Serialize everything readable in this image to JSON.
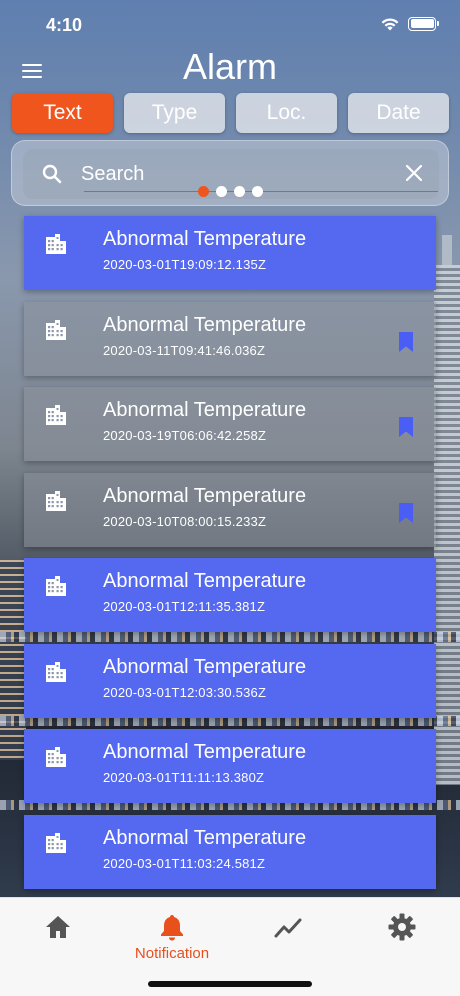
{
  "status": {
    "time": "4:10"
  },
  "header": {
    "title": "Alarm"
  },
  "filters": [
    {
      "label": "Text",
      "active": true
    },
    {
      "label": "Type",
      "active": false
    },
    {
      "label": "Loc.",
      "active": false
    },
    {
      "label": "Date",
      "active": false
    }
  ],
  "search": {
    "placeholder": "Search",
    "page_count": 4,
    "active_page": 1
  },
  "alarms": [
    {
      "title": "Abnormal Temperature",
      "time": "2020-03-01T19:09:12.135Z",
      "unread": true,
      "bookmarked": false
    },
    {
      "title": "Abnormal Temperature",
      "time": "2020-03-11T09:41:46.036Z",
      "unread": false,
      "bookmarked": true
    },
    {
      "title": "Abnormal Temperature",
      "time": "2020-03-19T06:06:42.258Z",
      "unread": false,
      "bookmarked": true
    },
    {
      "title": "Abnormal Temperature",
      "time": "2020-03-10T08:00:15.233Z",
      "unread": false,
      "bookmarked": true
    },
    {
      "title": "Abnormal Temperature",
      "time": "2020-03-01T12:11:35.381Z",
      "unread": true,
      "bookmarked": false
    },
    {
      "title": "Abnormal Temperature",
      "time": "2020-03-01T12:03:30.536Z",
      "unread": true,
      "bookmarked": false
    },
    {
      "title": "Abnormal Temperature",
      "time": "2020-03-01T11:11:13.380Z",
      "unread": true,
      "bookmarked": false
    },
    {
      "title": "Abnormal Temperature",
      "time": "2020-03-01T11:03:24.581Z",
      "unread": true,
      "bookmarked": false
    }
  ],
  "tabbar": {
    "active": "notification",
    "notification_label": "Notification"
  },
  "colors": {
    "accent": "#f0551d",
    "unread_item": "#5468f0",
    "bookmark": "#4a5ef5",
    "tab_icon": "#555555"
  },
  "icons": {
    "menu": "menu-icon",
    "search": "search-icon",
    "clear": "close-icon",
    "item": "building-icon",
    "bookmark": "bookmark-icon",
    "home": "home-icon",
    "notification": "bell-icon",
    "trend": "trend-icon",
    "settings": "gear-icon"
  }
}
